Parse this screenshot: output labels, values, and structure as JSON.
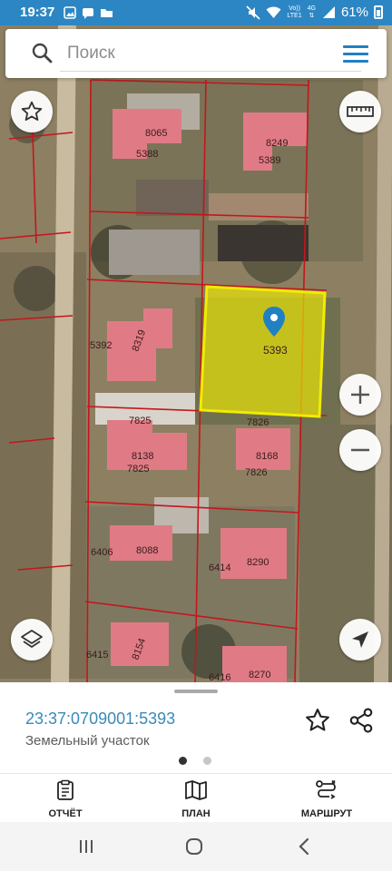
{
  "status": {
    "time": "19:37",
    "network": [
      "Vo))",
      "LTE1",
      "4G"
    ],
    "battery": "61%"
  },
  "search": {
    "placeholder": "Поиск"
  },
  "map": {
    "selected_parcel": "5393",
    "parcel_labels": [
      "8065",
      "5388",
      "8249",
      "5389",
      "5392",
      "8319",
      "7825",
      "8138",
      "7825",
      "7826",
      "8168",
      "7826",
      "6406",
      "8088",
      "6414",
      "8290",
      "6415",
      "8154",
      "6416",
      "8270"
    ]
  },
  "card": {
    "cadastral_number": "23:37:0709001:5393",
    "object_type": "Земельный участок"
  },
  "tabs": [
    {
      "label": "ОТЧЁТ",
      "icon": "report-icon"
    },
    {
      "label": "ПЛАН",
      "icon": "map-plan-icon"
    },
    {
      "label": "МАРШРУТ",
      "icon": "route-icon"
    }
  ],
  "colors": {
    "status_bar": "#2d86c4",
    "accent": "#2180c2",
    "building": "#e07b86",
    "selected_parcel": "#f1ec00",
    "parcel_border": "#c4161c"
  }
}
